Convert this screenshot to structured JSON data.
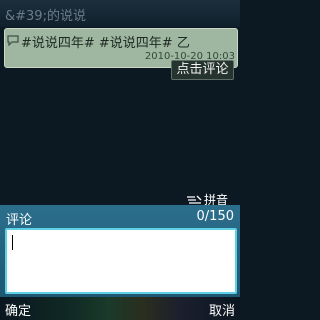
{
  "titlebar": {
    "title": "&#39;的说说"
  },
  "post": {
    "text": "#说说四年# #说说四年# 乙",
    "timestamp": "2010-10-20 10:03"
  },
  "actions": {
    "comment_label": "点击评论"
  },
  "ime": {
    "mode": "拼音",
    "icon": "pen-input-icon"
  },
  "composer": {
    "label": "评论",
    "counter": "0/150",
    "value": ""
  },
  "softkeys": {
    "left": "确定",
    "right": "取消"
  }
}
